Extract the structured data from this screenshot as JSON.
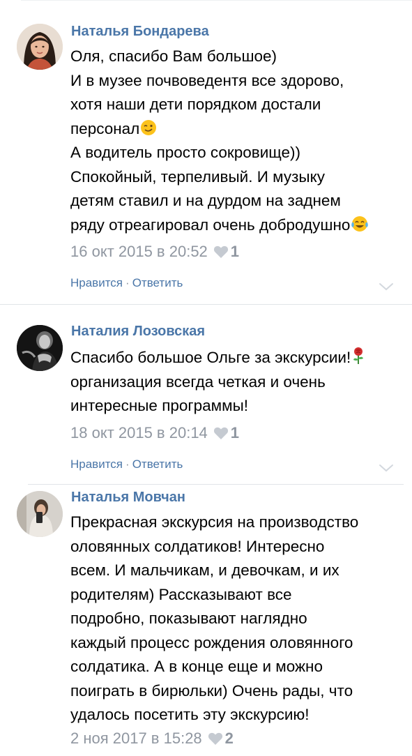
{
  "comments": [
    {
      "author": "Наталья Бондарева",
      "lines": [
        "Оля, спасибо Вам большое)",
        "И в музее почвоведентя все здорово,",
        "хотя наши дети порядком достали",
        "персонал",
        "А водитель просто сокровище))",
        "Спокойный, терпеливый. И музыку",
        "детям ставил и на дурдом на заднем",
        "ряду отреагировал очень добродушно"
      ],
      "emojis": [
        "winking-face-emoji",
        "tears-of-joy-emoji"
      ],
      "date": "16 окт 2015 в 20:52",
      "likes": "1",
      "like_label": "Нравится",
      "separator": "·",
      "reply_label": "Ответить"
    },
    {
      "author": "Наталия Лозовская",
      "lines": [
        "Спасибо большое Ольге за экскурсии!",
        "организация всегда четкая и очень",
        "интересные программы!"
      ],
      "emojis": [
        "rose-emoji"
      ],
      "date": "18 окт 2015 в 20:14",
      "likes": "1",
      "like_label": "Нравится",
      "separator": "·",
      "reply_label": "Ответить"
    },
    {
      "author": "Наталья Мовчан",
      "lines": [
        "Прекрасная экскурсия на производство",
        "оловянных солдатиков! Интересно",
        "всем. И мальчикам, и девочкам, и их",
        "родителям) Рассказывают все",
        "подробно, показывают наглядно",
        "каждый процесс рождения оловянного",
        "солдатика. А в конце еще и можно",
        "поиграть в бирюльки) Очень рады, что",
        "удалось посетить эту экскурсию!"
      ],
      "date": "2 ноя 2017 в 15:28",
      "likes": "2"
    }
  ],
  "colors": {
    "author": "#4a76a8",
    "meta": "#8f96a0",
    "divider": "#e1e4e8"
  },
  "icons": {
    "like": "heart-icon",
    "expand": "chevron-down-icon"
  }
}
